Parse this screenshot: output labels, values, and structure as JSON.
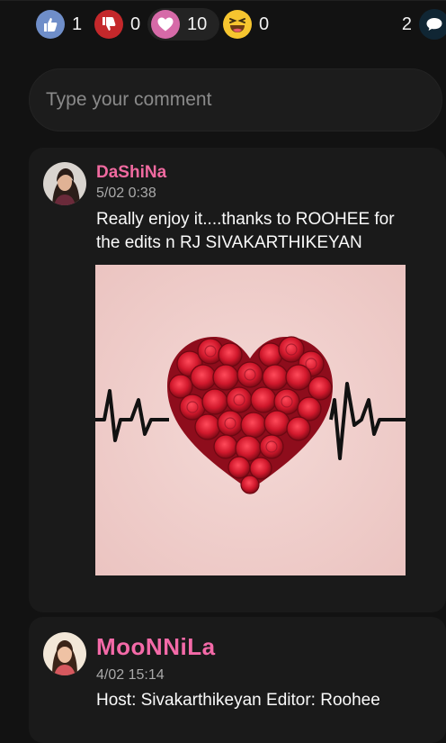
{
  "reactions": {
    "like": {
      "icon": "thumbs-up-icon",
      "count": "1",
      "color": "#6f8ec9"
    },
    "dislike": {
      "icon": "thumbs-down-icon",
      "count": "0",
      "color": "#c4282b"
    },
    "love": {
      "icon": "heart-icon",
      "count": "10",
      "color": "#d66aa8"
    },
    "haha": {
      "icon": "laughing-face-icon",
      "count": "0",
      "color": "#f6c52f"
    },
    "comments": {
      "icon": "speech-bubble-icon",
      "count": "2"
    }
  },
  "comment_box": {
    "placeholder": "Type your comment"
  },
  "comments": [
    {
      "author": "DaShiNa",
      "author_color": "#f06aa0",
      "time": "5/02 0:38",
      "text": "Really enjoy it....thanks to ROOHEE for the edits n RJ SIVAKARTHIKEYAN",
      "attachment": "heart-of-roses-with-heartbeat-line-image"
    },
    {
      "author": "MooNNiLa",
      "author_color": "#f46aa8",
      "time": "4/02 15:14",
      "text": "Host: Sivakarthikeyan Editor: Roohee"
    }
  ]
}
